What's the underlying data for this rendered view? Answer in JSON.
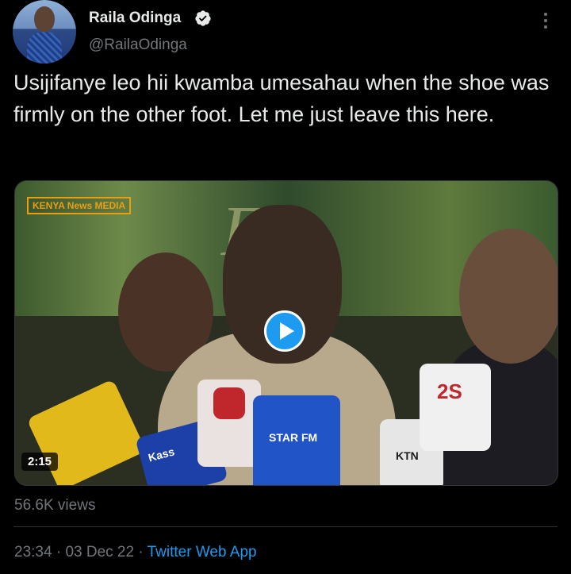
{
  "tweet": {
    "author_name": "Raila Odinga",
    "handle": "@RailaOdinga",
    "verified": true,
    "text": "Usijifanye leo hii kwamba umesahau when the shoe was firmly on the other foot. Let me just leave this here.",
    "media": {
      "watermark": "KENYA News MEDIA",
      "duration": "2:15",
      "mic_labels": [
        "STAR FM",
        "Kass",
        "KTN",
        "2S"
      ]
    },
    "views": "56.6K views",
    "time": "23:34",
    "date": "03 Dec 22",
    "separator": "·",
    "source_app": "Twitter Web App"
  },
  "colors": {
    "background": "#000000",
    "accent": "#1d9bf0",
    "muted_text": "#71767b",
    "text": "#e7e9ea"
  },
  "icons": {
    "verified": "verified-badge-icon",
    "more": "more-options-icon",
    "play": "play-icon"
  }
}
